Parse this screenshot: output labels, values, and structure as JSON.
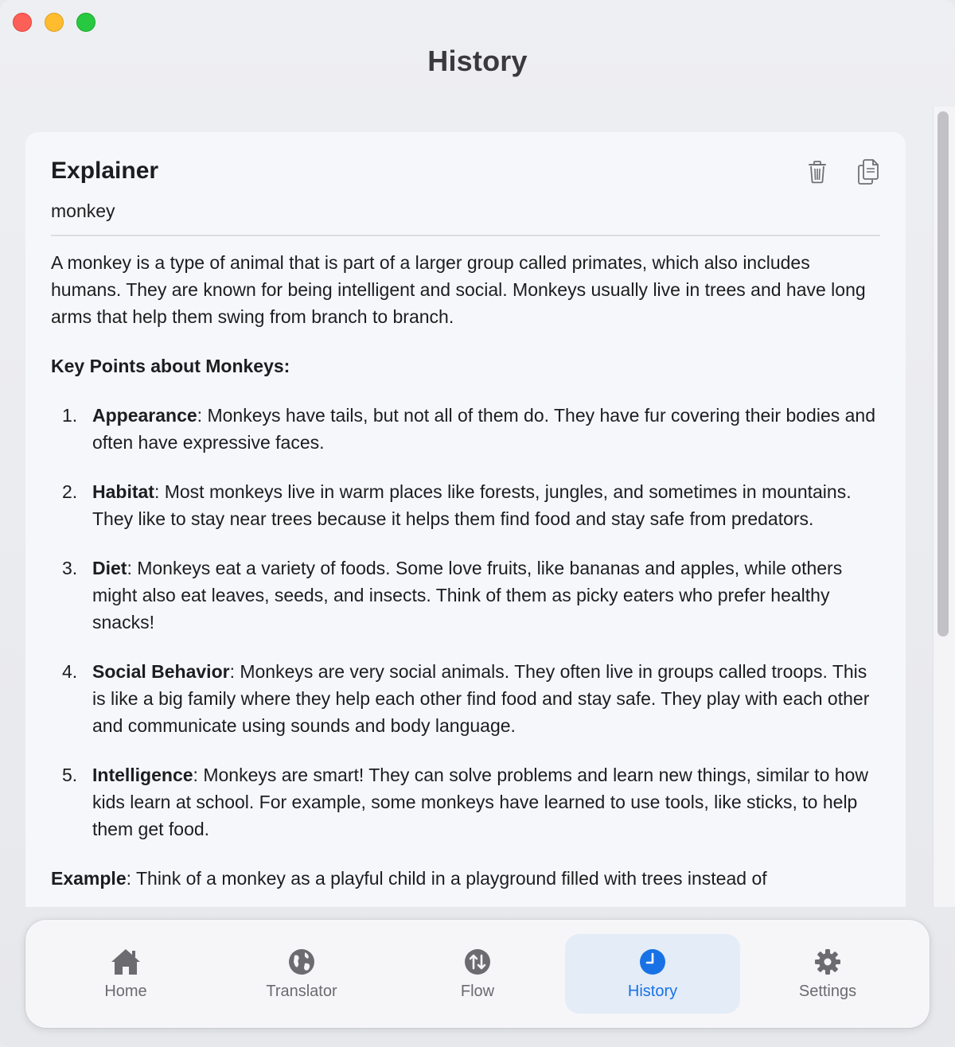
{
  "window": {
    "title": "History"
  },
  "card": {
    "title": "Explainer",
    "query": "monkey",
    "intro": "A monkey is a type of animal that is part of a larger group called primates, which also includes humans. They are known for being intelligent and social. Monkeys usually live in trees and have long arms that help them swing from branch to branch.",
    "key_heading": "Key Points about Monkeys:",
    "points": [
      {
        "num": "1.",
        "term": "Appearance",
        "text": ": Monkeys have tails, but not all of them do. They have fur covering their bodies and often have expressive faces."
      },
      {
        "num": "2.",
        "term": "Habitat",
        "text": ": Most monkeys live in warm places like forests, jungles, and sometimes in mountains. They like to stay near trees because it helps them find food and stay safe from predators."
      },
      {
        "num": "3.",
        "term": "Diet",
        "text": ": Monkeys eat a variety of foods. Some love fruits, like bananas and apples, while others might also eat leaves, seeds, and insects. Think of them as picky eaters who prefer healthy snacks!"
      },
      {
        "num": "4.",
        "term": "Social Behavior",
        "text": ": Monkeys are very social animals. They often live in groups called troops. This is like a big family where they help each other find food and stay safe. They play with each other and communicate using sounds and body language."
      },
      {
        "num": "5.",
        "term": "Intelligence",
        "text": ": Monkeys are smart! They can solve problems and learn new things, similar to how kids learn at school. For example, some monkeys have learned to use tools, like sticks, to help them get food."
      }
    ],
    "example_term": "Example",
    "example_text": ": Think of a monkey as a playful child in a playground filled with trees instead of",
    "actions": {
      "delete_icon": "trash-icon",
      "copy_icon": "copy-icon"
    }
  },
  "tabs": [
    {
      "label": "Home",
      "icon": "house-icon",
      "active": false
    },
    {
      "label": "Translator",
      "icon": "globe-icon",
      "active": false
    },
    {
      "label": "Flow",
      "icon": "arrows-updown-icon",
      "active": false
    },
    {
      "label": "History",
      "icon": "clock-icon",
      "active": true
    },
    {
      "label": "Settings",
      "icon": "gear-icon",
      "active": false
    }
  ],
  "colors": {
    "accent": "#1872e6",
    "active_tab_bg": "#e4ecf7"
  }
}
